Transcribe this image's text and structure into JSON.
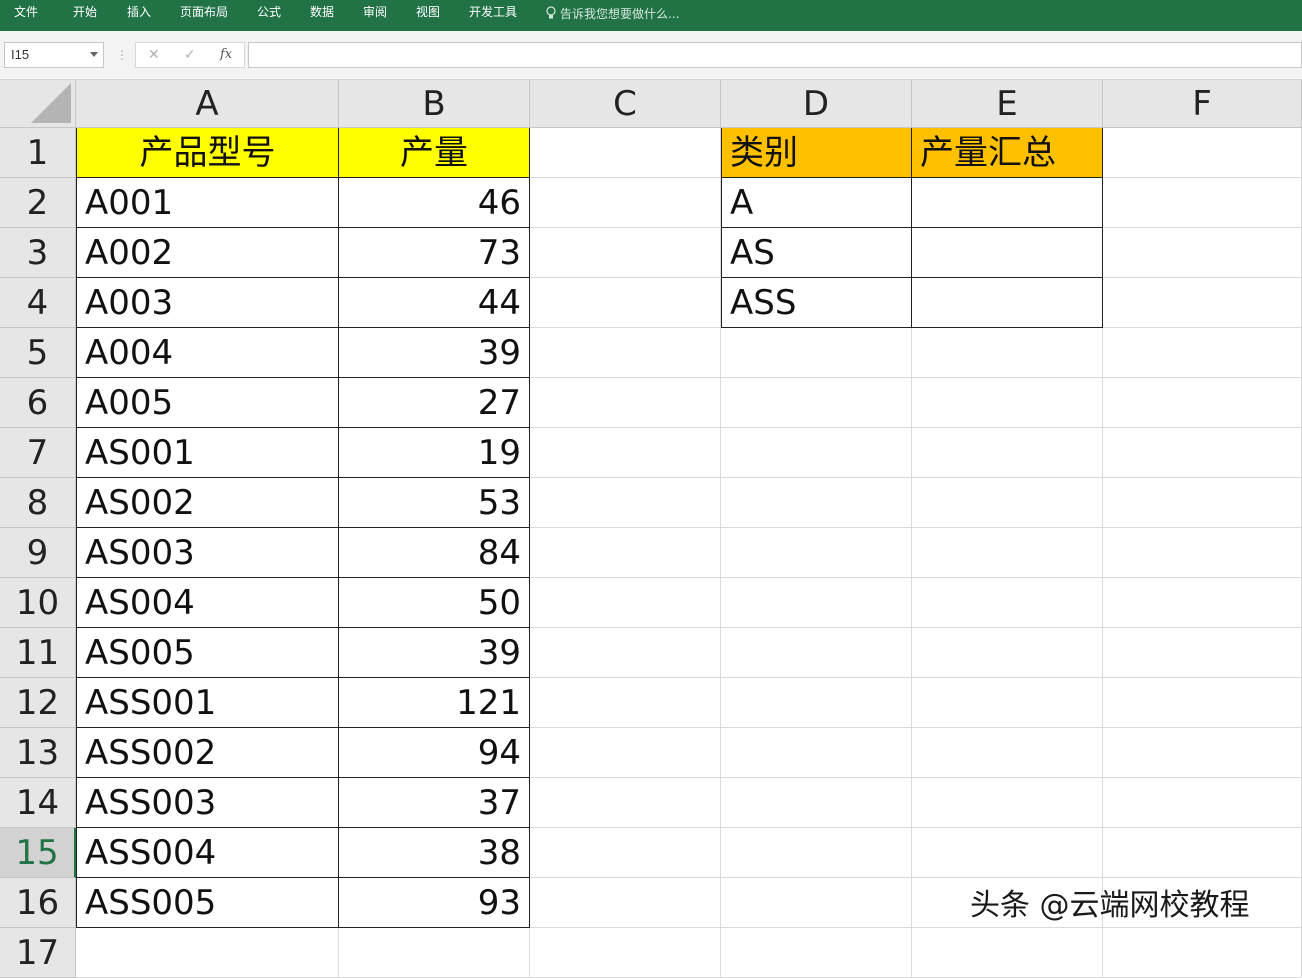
{
  "ribbon": {
    "tabs": [
      "文件",
      "开始",
      "插入",
      "页面布局",
      "公式",
      "数据",
      "审阅",
      "视图",
      "开发工具"
    ],
    "tell_me": "告诉我您想要做什么..."
  },
  "formula_bar": {
    "name_box": "I15",
    "cancel_icon": "✕",
    "enter_icon": "✓",
    "fx_label": "fx",
    "formula": ""
  },
  "columns": [
    "A",
    "B",
    "C",
    "D",
    "E",
    "F"
  ],
  "rows": [
    "1",
    "2",
    "3",
    "4",
    "5",
    "6",
    "7",
    "8",
    "9",
    "10",
    "11",
    "12",
    "13",
    "14",
    "15",
    "16",
    "17"
  ],
  "active_row": "15",
  "table_main": {
    "headers": [
      "产品型号",
      "产量"
    ],
    "rows": [
      [
        "A001",
        "46"
      ],
      [
        "A002",
        "73"
      ],
      [
        "A003",
        "44"
      ],
      [
        "A004",
        "39"
      ],
      [
        "A005",
        "27"
      ],
      [
        "AS001",
        "19"
      ],
      [
        "AS002",
        "53"
      ],
      [
        "AS003",
        "84"
      ],
      [
        "AS004",
        "50"
      ],
      [
        "AS005",
        "39"
      ],
      [
        "ASS001",
        "121"
      ],
      [
        "ASS002",
        "94"
      ],
      [
        "ASS003",
        "37"
      ],
      [
        "ASS004",
        "38"
      ],
      [
        "ASS005",
        "93"
      ]
    ]
  },
  "table_summary": {
    "headers": [
      "类别",
      "产量汇总"
    ],
    "rows": [
      [
        "A",
        ""
      ],
      [
        "AS",
        ""
      ],
      [
        "ASS",
        ""
      ]
    ]
  },
  "colors": {
    "ribbon": "#217346",
    "header_yellow": "#ffff00",
    "header_orange": "#ffc000"
  },
  "watermark": "头条 @云端网校教程"
}
